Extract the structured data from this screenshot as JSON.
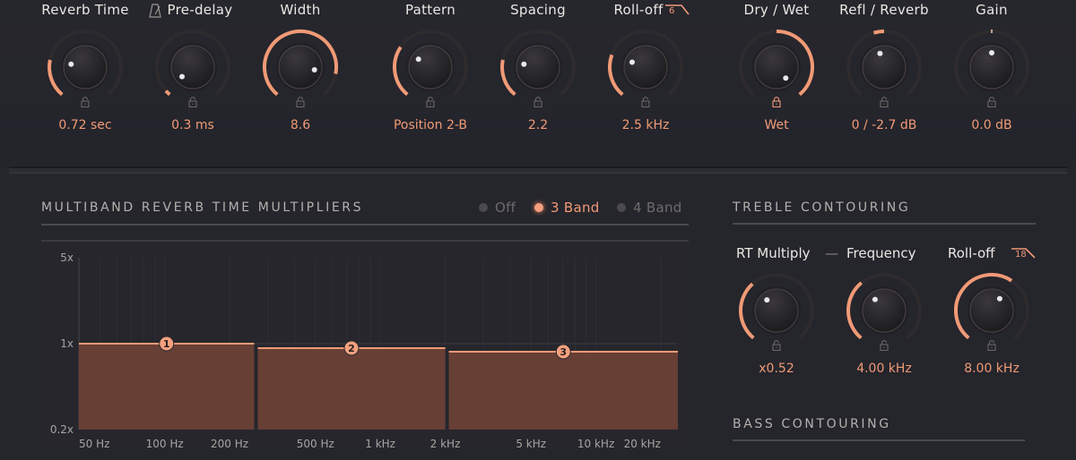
{
  "colors": {
    "accent": "#f09a76",
    "background": "#25252c",
    "text": "#ebe7e3",
    "muted": "#6e6b6a"
  },
  "top_knobs": [
    {
      "label": "Reverb Time",
      "value": "0.72 sec",
      "fraction": 0.22,
      "locked": false,
      "mode": "min"
    },
    {
      "label": "Pre-delay",
      "value": "0.3 ms",
      "fraction": 0.03,
      "locked": false,
      "mode": "min"
    },
    {
      "label": "Width",
      "value": "8.6",
      "fraction": 0.86,
      "locked": false,
      "mode": "min"
    },
    {
      "label": "Pattern",
      "value": "Position 2-B",
      "fraction": 0.3,
      "locked": false,
      "mode": "min"
    },
    {
      "label": "Spacing",
      "value": "2.2",
      "fraction": 0.22,
      "locked": false,
      "mode": "min"
    },
    {
      "label": "Roll-off",
      "value": "2.5 kHz",
      "fraction": 0.25,
      "locked": false,
      "mode": "min"
    },
    {
      "label": "Dry / Wet",
      "value": "Wet",
      "fraction": 1.0,
      "locked": true,
      "mode": "center"
    },
    {
      "label": "Refl / Reverb",
      "value": "0 / -2.7 dB",
      "fraction": 0.44,
      "locked": false,
      "mode": "center"
    },
    {
      "label": "Gain",
      "value": "0.0 dB",
      "fraction": 0.5,
      "locked": false,
      "mode": "center"
    }
  ],
  "predelay_sync_icon": "metronome-icon",
  "rolloff_slope": "6",
  "multiband": {
    "title": "MULTIBAND REVERB TIME MULTIPLIERS",
    "modes": [
      {
        "label": "Off",
        "selected": false
      },
      {
        "label": "3 Band",
        "selected": true
      },
      {
        "label": "4 Band",
        "selected": false
      }
    ]
  },
  "chart_data": {
    "type": "bar",
    "title": "Multiband Reverb Time Multipliers",
    "xscale": "log",
    "xlim": [
      40,
      24000
    ],
    "ylim": [
      0.2,
      5
    ],
    "yscale": "log",
    "y_ticks": [
      "5x",
      "1x",
      "0.2x"
    ],
    "y_tick_values": [
      5,
      1,
      0.2
    ],
    "x_ticks": [
      "50 Hz",
      "100 Hz",
      "200 Hz",
      "500 Hz",
      "1 kHz",
      "2 kHz",
      "5 kHz",
      "10 kHz",
      "20 kHz"
    ],
    "x_tick_values": [
      50,
      100,
      200,
      500,
      1000,
      2000,
      5000,
      10000,
      20000
    ],
    "bands": [
      {
        "name": "1",
        "from_hz": 40,
        "to_hz": 260,
        "multiplier": 1.0
      },
      {
        "name": "2",
        "from_hz": 260,
        "to_hz": 2000,
        "multiplier": 0.92
      },
      {
        "name": "3",
        "from_hz": 2000,
        "to_hz": 24000,
        "multiplier": 0.86
      }
    ]
  },
  "treble": {
    "title": "TREBLE CONTOURING",
    "link_dash": "—",
    "rolloff_slope": "18",
    "knobs": [
      {
        "label": "RT Multiply",
        "value": "x0.52",
        "fraction": 0.35
      },
      {
        "label": "Frequency",
        "value": "4.00 kHz",
        "fraction": 0.36
      },
      {
        "label": "Roll-off",
        "value": "8.00 kHz",
        "fraction": 0.62
      }
    ]
  },
  "bass": {
    "title": "BASS CONTOURING"
  }
}
